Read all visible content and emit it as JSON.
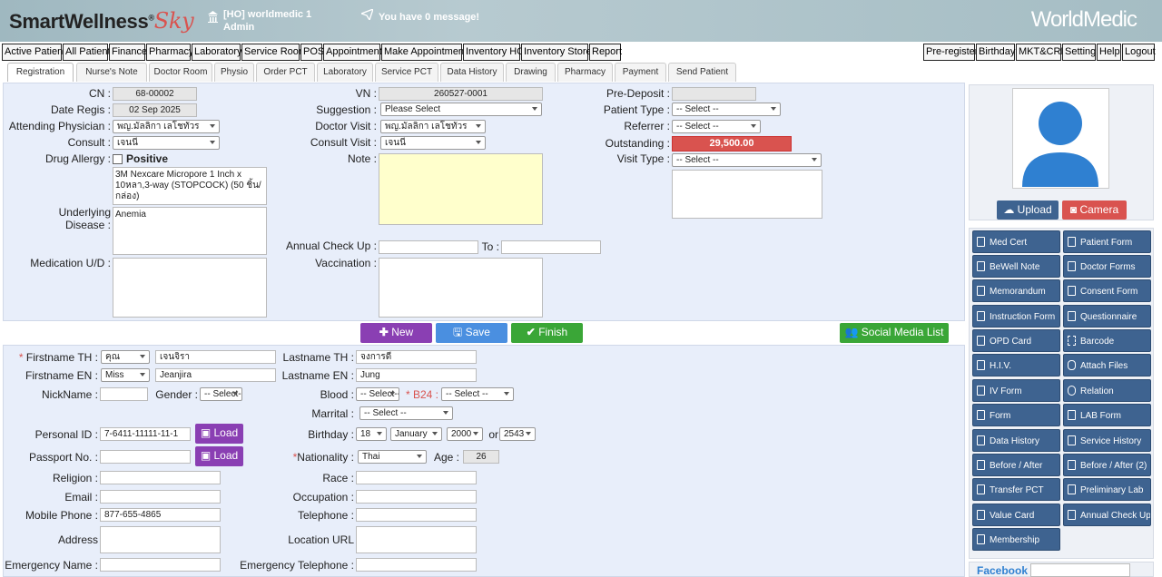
{
  "header": {
    "logo_main": "SmartWellness",
    "logo_reg": "®",
    "logo_sky": "Sky",
    "hospital": "[HO] worldmedic 1",
    "user": "Admin",
    "message": "You have 0 message!",
    "brand": "WorldMedic"
  },
  "menu_left": [
    "Active Patient",
    "All Patient",
    "Finance",
    "Pharmacy",
    "Laboratory",
    "Service Room",
    "POS",
    "Appointment",
    "Make Appointment",
    "Inventory HO",
    "Inventory Store",
    "Report"
  ],
  "menu_right": [
    "Pre-register",
    "Birthday",
    "MKT&CRM",
    "Setting",
    "Help",
    "Logout"
  ],
  "tabs": [
    "Registration",
    "Nurse's Note",
    "Doctor Room",
    "Physio",
    "Order PCT",
    "Laboratory",
    "Service PCT",
    "Data History",
    "Drawing",
    "Pharmacy",
    "Payment",
    "Send Patient"
  ],
  "visit": {
    "cn_label": "CN :",
    "cn": "68-00002",
    "date_label": "Date Regis :",
    "date": "02 Sep 2025",
    "attending_label": "Attending Physician :",
    "attending": "พญ.มัลลิกา เลโชทัวร",
    "consult_label": "Consult :",
    "consult": "เจนนี่",
    "drug_label": "Drug Allergy :",
    "drug_positive": "Positive",
    "drug_text": "3M Nexcare Micropore 1 Inch x 10หลา,3-way (STOPCOCK) (50 ชิ้น/กล่อง)",
    "underlying_label": "Underlying Disease :",
    "underlying": "Anemia",
    "medication_label": "Medication U/D :",
    "vn_label": "VN :",
    "vn": "260527-0001",
    "suggestion_label": "Suggestion :",
    "suggestion": "Please Select",
    "doctor_visit_label": "Doctor Visit :",
    "doctor_visit": "พญ.มัลลิกา เลโชทัวร",
    "consult_visit_label": "Consult Visit :",
    "consult_visit": "เจนนี่",
    "note_label": "Note :",
    "annual_label": "Annual Check Up :",
    "to_label": "To :",
    "vaccination_label": "Vaccination :",
    "predeposit_label": "Pre-Deposit :",
    "patient_type_label": "Patient Type :",
    "patient_type": "-- Select --",
    "referrer_label": "Referrer :",
    "referrer": "-- Select --",
    "outstanding_label": "Outstanding :",
    "outstanding": "29,500.00",
    "visit_type_label": "Visit Type :",
    "visit_type": "-- Select --"
  },
  "actions": {
    "new": "New",
    "save": "Save",
    "finish": "Finish",
    "social": "Social Media List"
  },
  "patient": {
    "fname_th_label": "Firstname TH :",
    "title_th": "คุณ",
    "fname_th": "เจนจิรา",
    "lname_th_label": "Lastname TH :",
    "lname_th": "จงการดี",
    "fname_en_label": "Firstname EN :",
    "title_en": "Miss",
    "fname_en": "Jeanjira",
    "lname_en_label": "Lastname EN :",
    "lname_en": "Jung",
    "nickname_label": "NickName :",
    "gender_label": "Gender :",
    "gender": "-- Select--",
    "blood_label": "Blood :",
    "blood": "-- Select--",
    "b24_label": "B24 :",
    "b24": "-- Select --",
    "marital_label": "Marrital :",
    "marital": "-- Select --",
    "pid_label": "Personal ID :",
    "pid": "7-6411-11111-11-1",
    "load": "Load",
    "birthday_label": "Birthday :",
    "bday": "18",
    "bmonth": "January",
    "byear": "2000",
    "or": "or",
    "byear_th": "2543",
    "passport_label": "Passport No. :",
    "nationality_label": "Nationality :",
    "nationality": "Thai",
    "age_label": "Age :",
    "age": "26",
    "religion_label": "Religion :",
    "race_label": "Race :",
    "email_label": "Email :",
    "occupation_label": "Occupation :",
    "mobile_label": "Mobile Phone :",
    "mobile": "877-655-4865",
    "telephone_label": "Telephone :",
    "address_label": "Address",
    "location_label": "Location URL",
    "emergency_label": "Emergency Name :",
    "emergency_tel_label": "Emergency Telephone :"
  },
  "sidebar": {
    "upload": "Upload",
    "camera": "Camera",
    "buttons": [
      "Med Cert",
      "Patient Form",
      "BeWell Note",
      "Doctor Forms",
      "Memorandum",
      "Consent Form",
      "Instruction Form",
      "Questionnaire",
      "OPD Card",
      "Barcode",
      "H.I.V.",
      "Attach Files",
      "IV Form",
      "Relation",
      "Form",
      "LAB Form",
      "Data History",
      "Service History",
      "Before / After",
      "Before / After (2)",
      "Transfer PCT",
      "Preliminary Lab",
      "Value Card",
      "Annual Check Up",
      "Membership"
    ],
    "facebook": "Facebook :"
  },
  "colors": {
    "purple": "#8a3fb3",
    "blue": "#4a8fe0",
    "green": "#3aa637",
    "navy": "#3e6390",
    "red": "#d9534f"
  }
}
